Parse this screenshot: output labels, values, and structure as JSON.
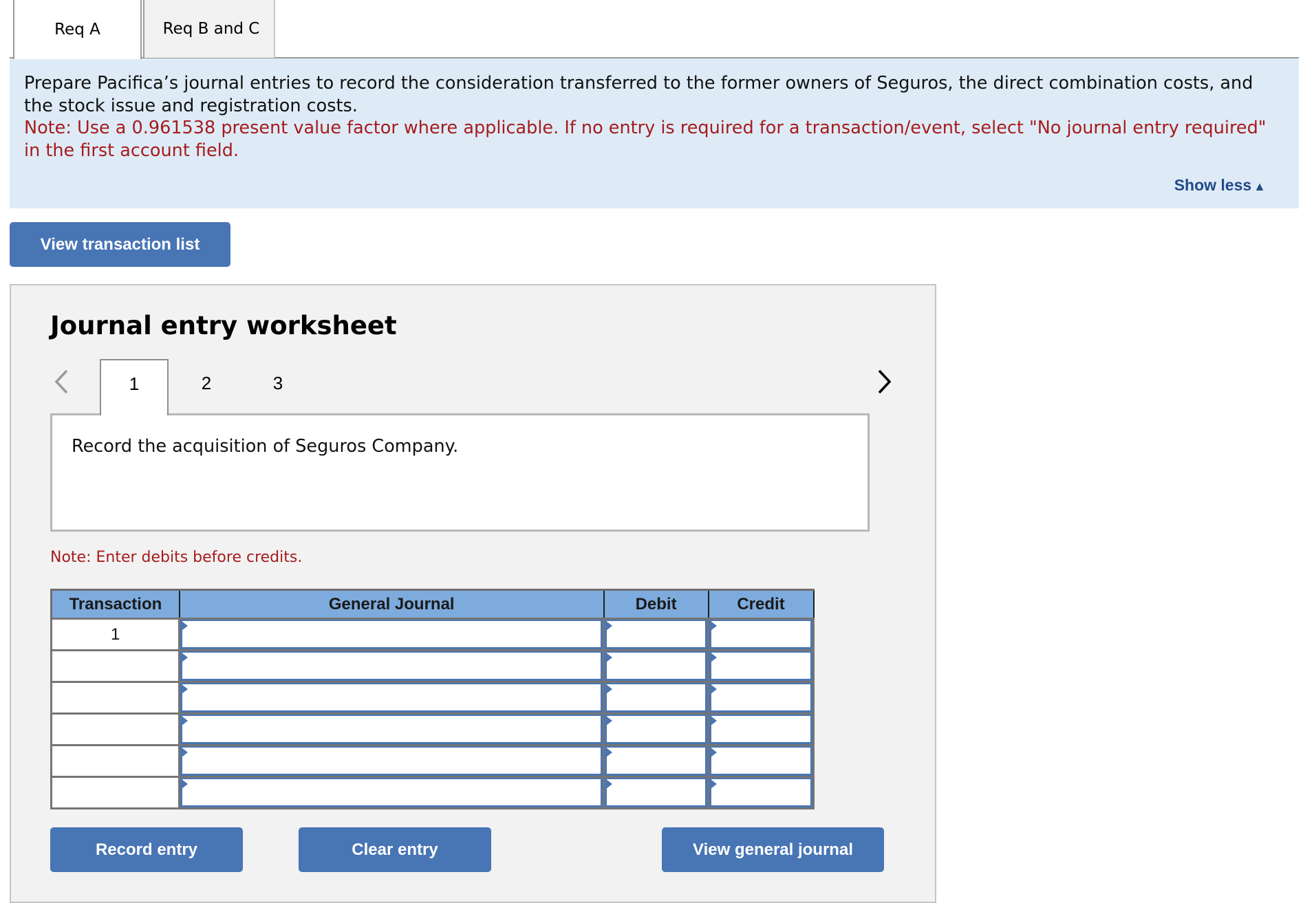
{
  "tabs": [
    {
      "label": "Req A",
      "active": true
    },
    {
      "label": "Req B and C",
      "active": false
    }
  ],
  "instructions": {
    "main": "Prepare Pacifica’s journal entries to record the consideration transferred to the former owners of Seguros, the direct combination costs, and the stock issue and registration costs.",
    "note": "Note: Use a 0.961538 present value factor where applicable. If no entry is required for a transaction/event, select \"No journal entry required\" in the first account field.",
    "toggle_label": "Show less",
    "toggle_icon": "triangle-up-icon",
    "toggle_glyph": "▲"
  },
  "view_transaction_list_label": "View transaction list",
  "worksheet": {
    "title": "Journal entry worksheet",
    "prev_glyph": "<",
    "next_glyph": ">",
    "pages": [
      "1",
      "2",
      "3"
    ],
    "current_page": "1",
    "description": "Record the acquisition of Seguros Company.",
    "entry_note": "Note: Enter debits before credits.",
    "table": {
      "columns": [
        "Transaction",
        "General Journal",
        "Debit",
        "Credit"
      ],
      "rows": [
        {
          "transaction": "1",
          "account": "",
          "debit": "",
          "credit": ""
        },
        {
          "transaction": "",
          "account": "",
          "debit": "",
          "credit": ""
        },
        {
          "transaction": "",
          "account": "",
          "debit": "",
          "credit": ""
        },
        {
          "transaction": "",
          "account": "",
          "debit": "",
          "credit": ""
        },
        {
          "transaction": "",
          "account": "",
          "debit": "",
          "credit": ""
        },
        {
          "transaction": "",
          "account": "",
          "debit": "",
          "credit": ""
        }
      ]
    },
    "buttons": {
      "record": "Record entry",
      "clear": "Clear entry",
      "view_general_journal": "View general journal"
    }
  },
  "colors": {
    "accent_button": "#4875b4",
    "panel_bg": "#deebf7",
    "note_red": "#a61c1c",
    "link_blue": "#234a86",
    "table_header": "#7eabdd"
  }
}
